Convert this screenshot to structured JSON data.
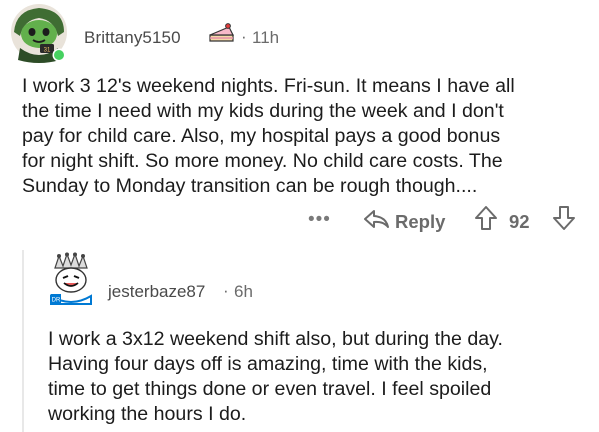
{
  "comment": {
    "username": "Brittany5150",
    "separator": "·",
    "time": "11h",
    "lines": [
      "I work 3 12's weekend nights. Fri-sun. It means I have all",
      "the time I need with my kids during the week and I don't",
      "pay for child care. Also, my hospital pays a good bonus",
      "for night shift. So more money. No child care costs. The",
      "Sunday to Monday transition can be rough though...."
    ],
    "actions": {
      "more": "•••",
      "reply_label": "Reply",
      "score": "92"
    }
  },
  "reply": {
    "username": "jesterbaze87",
    "separator": "·",
    "time": "6h",
    "lines": [
      "I work a 3x12 weekend shift also, but during the day.",
      "Having four days off is amazing, time with the kids,",
      "time to get things done or even travel. I feel spoiled",
      "working the hours I do."
    ]
  },
  "colors": {
    "online_dot": "#46d160",
    "avatar1_bg": "#4c8a3a",
    "avatar2_ring": "#0079d3",
    "thread_line": "#e8e8e8"
  },
  "icons": {
    "avatar1": "snoo-avatar-green",
    "flair": "cake-flair-icon",
    "reply": "reply-arrow-icon",
    "upvote": "upvote-arrow-icon",
    "downvote": "downvote-arrow-icon",
    "avatar2": "snoo-avatar-jester"
  }
}
